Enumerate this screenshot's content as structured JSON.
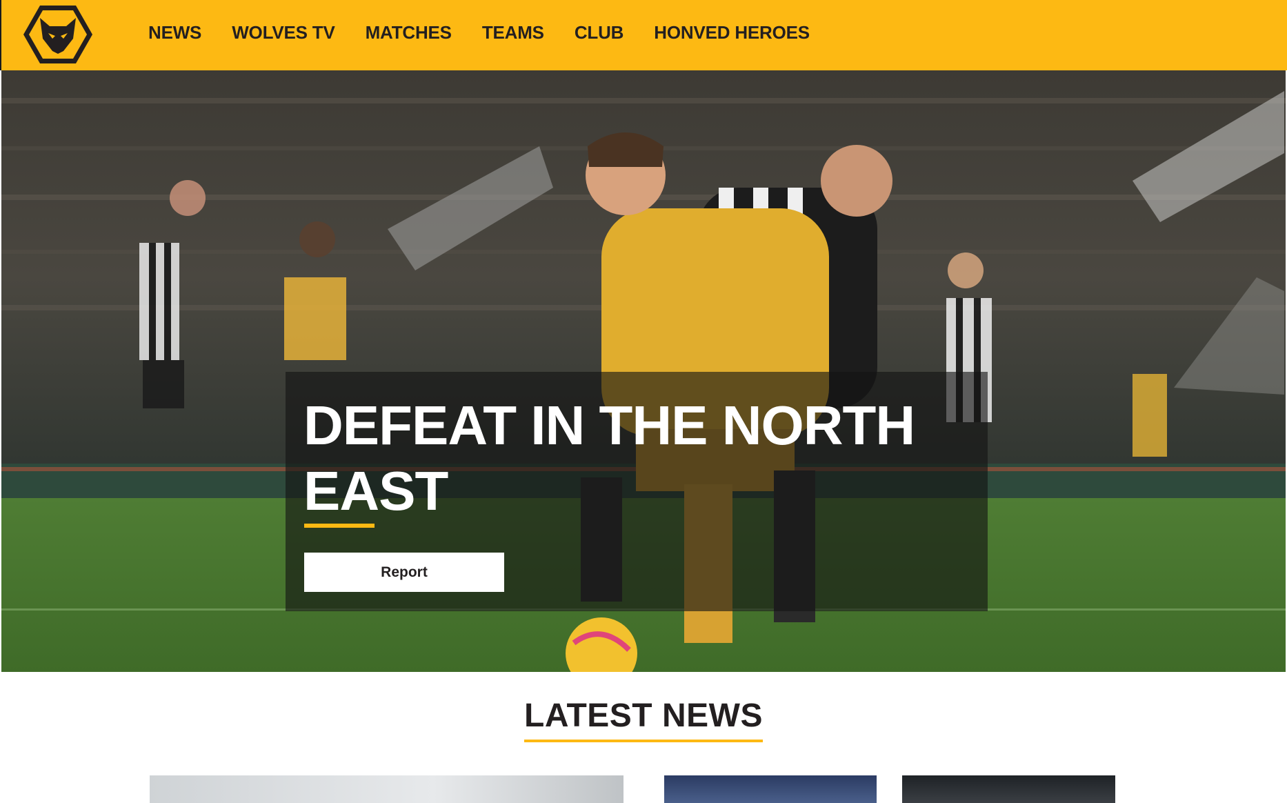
{
  "header": {
    "logo_icon": "wolf-head-icon",
    "brand_color": "#fdb913",
    "nav": [
      {
        "label": "NEWS"
      },
      {
        "label": "WOLVES TV"
      },
      {
        "label": "MATCHES"
      },
      {
        "label": "TEAMS"
      },
      {
        "label": "CLUB"
      },
      {
        "label": "HONVED HEROES"
      }
    ]
  },
  "hero": {
    "title": "DEFEAT IN THE NORTH EAST",
    "button_label": "Report",
    "accent_color": "#fdb913"
  },
  "latest_news": {
    "heading": "LATEST NEWS"
  }
}
